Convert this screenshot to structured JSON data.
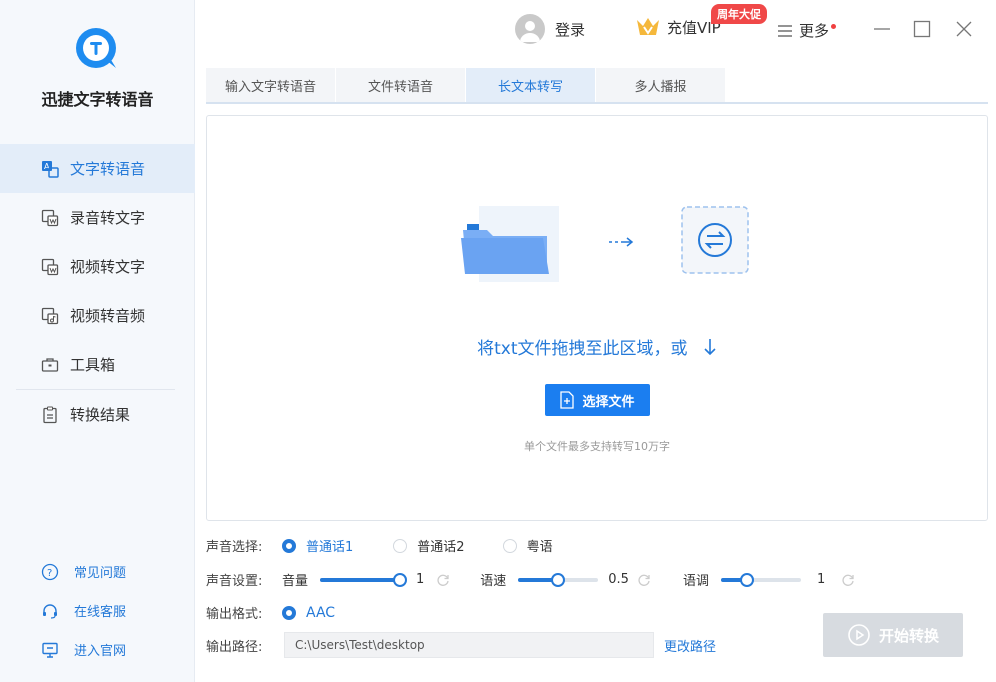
{
  "app": {
    "name": "迅捷文字转语音"
  },
  "sidebar": {
    "items": [
      {
        "label": "文字转语音",
        "icon": "text-to-speech-icon",
        "active": true
      },
      {
        "label": "录音转文字",
        "icon": "recording-icon"
      },
      {
        "label": "视频转文字",
        "icon": "video-text-icon"
      },
      {
        "label": "视频转音频",
        "icon": "video-audio-icon"
      },
      {
        "label": "工具箱",
        "icon": "toolbox-icon"
      },
      {
        "label": "转换结果",
        "icon": "result-icon"
      }
    ],
    "bottom": [
      {
        "label": "常见问题",
        "icon": "help-icon"
      },
      {
        "label": "在线客服",
        "icon": "headset-icon"
      },
      {
        "label": "进入官网",
        "icon": "monitor-icon"
      }
    ]
  },
  "topbar": {
    "login": "登录",
    "vip": "充值VIP",
    "promo": "周年大促",
    "more": "更多"
  },
  "tabs": [
    {
      "label": "输入文字转语音"
    },
    {
      "label": "文件转语音"
    },
    {
      "label": "长文本转写",
      "active": true
    },
    {
      "label": "多人播报"
    }
  ],
  "droparea": {
    "prompt": "将txt文件拖拽至此区域，或",
    "button": "选择文件",
    "hint": "单个文件最多支持转写10万字"
  },
  "voice": {
    "label": "声音选择:",
    "options": [
      "普通话1",
      "普通话2",
      "粤语"
    ],
    "selected": 0
  },
  "settings": {
    "label": "声音设置:",
    "volume": {
      "label": "音量",
      "value": "1",
      "fraction": 1.0
    },
    "speed": {
      "label": "语速",
      "value": "0.5",
      "fraction": 0.5
    },
    "pitch": {
      "label": "语调",
      "value": "1",
      "fraction": 0.33
    }
  },
  "format": {
    "label": "输出格式:",
    "value": "AAC"
  },
  "output": {
    "label": "输出路径:",
    "path": "C:\\Users\\Test\\desktop",
    "change": "更改路径"
  },
  "start_button": "开始转换",
  "colors": {
    "accent": "#2479d8",
    "promo": "#f04848",
    "disabled": "#d7dbe0"
  }
}
